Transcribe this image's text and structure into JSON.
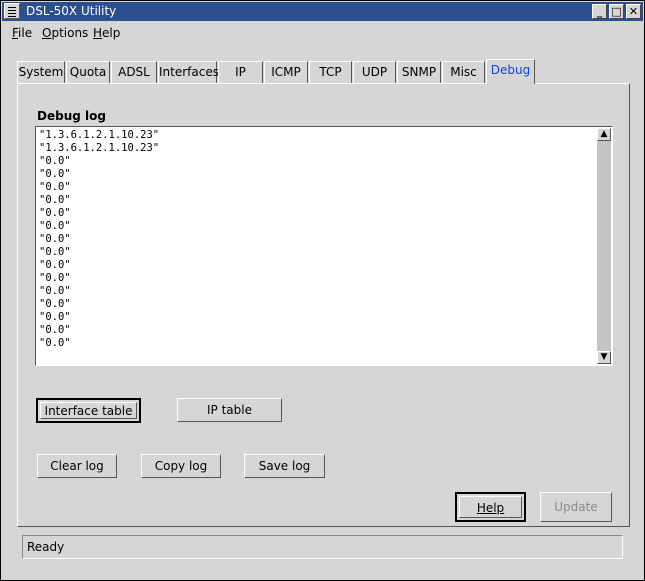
{
  "window": {
    "title": "DSL-50X Utility"
  },
  "menu": [
    {
      "label": "File",
      "mnemonic": "F",
      "rest": "ile"
    },
    {
      "label": "Options",
      "mnemonic": "O",
      "rest": "ptions"
    },
    {
      "label": "Help",
      "mnemonic": "H",
      "rest": "elp"
    }
  ],
  "tabs": [
    "System",
    "Quota",
    "ADSL",
    "Interfaces",
    "IP",
    "ICMP",
    "TCP",
    "UDP",
    "SNMP",
    "Misc",
    "Debug"
  ],
  "active_tab": "Debug",
  "debug": {
    "label": "Debug log",
    "lines": [
      "\"1.3.6.1.2.1.10.23\"",
      "\"1.3.6.1.2.1.10.23\"",
      "\"0.0\"",
      "\"0.0\"",
      "\"0.0\"",
      "\"0.0\"",
      "\"0.0\"",
      "\"0.0\"",
      "\"0.0\"",
      "\"0.0\"",
      "\"0.0\"",
      "\"0.0\"",
      "\"0.0\"",
      "\"0.0\"",
      "\"0.0\"",
      "\"0.0\"",
      "\"0.0\""
    ]
  },
  "buttons": {
    "interface_table": "Interface table",
    "ip_table": "IP table",
    "clear_log": "Clear log",
    "copy_log": "Copy log",
    "save_log": "Save log",
    "help": "Help",
    "update": "Update"
  },
  "status": "Ready"
}
